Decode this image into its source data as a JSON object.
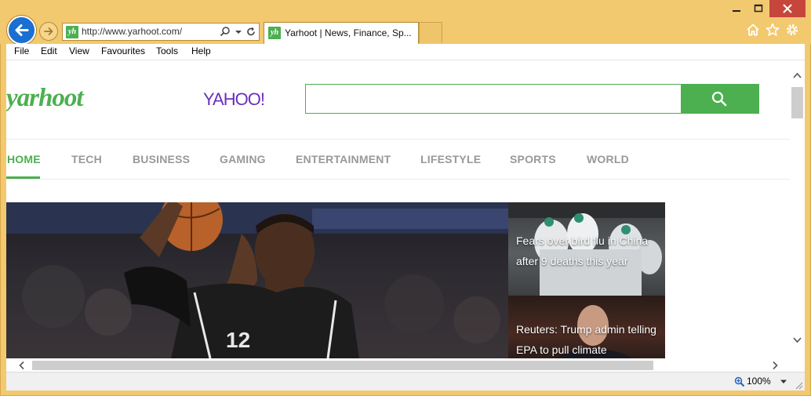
{
  "browser": {
    "address": {
      "url": "http://www.yarhoot.com/"
    },
    "tab": {
      "title": "Yarhoot | News, Finance, Sp...",
      "favicon_text": "yh"
    },
    "icons": {
      "back": "back-arrow-icon",
      "forward": "forward-arrow-icon",
      "search": "search-icon",
      "dropdown": "chevron-down-icon",
      "refresh": "refresh-icon",
      "home": "home-icon",
      "favorites": "star-icon",
      "settings": "gear-icon"
    },
    "menu": [
      "File",
      "Edit",
      "View",
      "Favourites",
      "Tools",
      "Help"
    ],
    "status": {
      "zoom": "100%"
    }
  },
  "page": {
    "logo": "yarhoot",
    "partner": "YAHOO!",
    "search": {
      "placeholder": ""
    },
    "nav": [
      "HOME",
      "TECH",
      "BUSINESS",
      "GAMING",
      "ENTERTAINMENT",
      "LIFESTYLE",
      "SPORTS",
      "WORLD"
    ],
    "news": [
      {
        "title": "Fears over bird flu in China after 9 deaths this year"
      },
      {
        "title": "Reuters: Trump admin telling EPA to pull climate"
      }
    ]
  },
  "colors": {
    "brand": "#4caf50",
    "partner": "#6b2fbf",
    "chrome": "#f2c96f",
    "close": "#c7463c"
  }
}
